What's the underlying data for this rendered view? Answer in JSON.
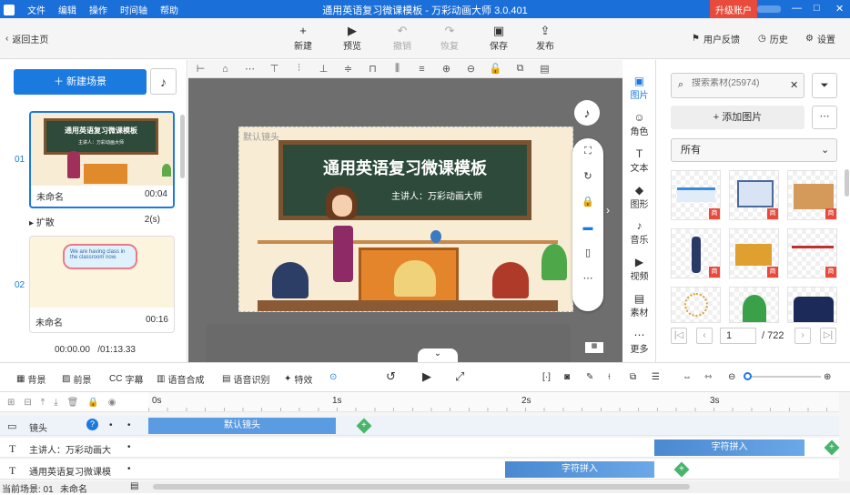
{
  "titlebar": {
    "menus": [
      "文件",
      "编辑",
      "操作",
      "时间轴",
      "帮助"
    ],
    "title": "通用英语复习微课模板 - 万彩动画大师 3.0.401",
    "upgrade": "升级账户",
    "min": "—",
    "max": "□",
    "close": "✕"
  },
  "toolbar": {
    "back": "返回主页",
    "buttons": [
      {
        "label": "新建",
        "icon": "+"
      },
      {
        "label": "预览",
        "icon": "▶"
      },
      {
        "label": "撤销",
        "icon": "↶"
      },
      {
        "label": "恢复",
        "icon": "↷"
      },
      {
        "label": "保存",
        "icon": "▣"
      },
      {
        "label": "发布",
        "icon": "⇪"
      }
    ],
    "feedback": "用户反馈",
    "history": "历史",
    "settings": "设置"
  },
  "left": {
    "new_scene": "新建场景",
    "scenes": [
      {
        "num": "01",
        "name": "未命名",
        "duration": "00:04",
        "board_title": "通用英语复习微课模板",
        "board_sub": "主讲人：万彩动画大师"
      },
      {
        "num": "02",
        "name": "未命名",
        "duration": "00:16",
        "bubble": "We are having class in the classroom now."
      }
    ],
    "transition": "扩散",
    "transition_time": "2(s)",
    "time_current": "00:00.00",
    "time_total": "/01:13.33"
  },
  "canvas": {
    "camera_label": "默认镜头",
    "board_title": "通用英语复习微课模板",
    "presenter": "主讲人：万彩动画大师"
  },
  "sidetabs": [
    {
      "label": "图片",
      "icon": "▣"
    },
    {
      "label": "角色",
      "icon": "☺"
    },
    {
      "label": "文本",
      "icon": "T"
    },
    {
      "label": "图形",
      "icon": "◆"
    },
    {
      "label": "音乐",
      "icon": "♪"
    },
    {
      "label": "视频",
      "icon": "▶"
    },
    {
      "label": "素材",
      "icon": "▤"
    },
    {
      "label": "更多",
      "icon": "⋯"
    }
  ],
  "rpanel": {
    "search_placeholder": "搜索素材(25974)",
    "add_image": "+ 添加图片",
    "category": "所有",
    "badge": "商",
    "page": "1",
    "total_pages": "/ 722"
  },
  "timeline": {
    "tools": [
      "背景",
      "前景",
      "字幕",
      "语音合成",
      "语音识别",
      "特效"
    ],
    "ticks": [
      "0s",
      "1s",
      "2s",
      "3s"
    ],
    "tracks": [
      {
        "name": "镜头",
        "clip": "默认镜头"
      },
      {
        "name": "主讲人：万彩动画大",
        "clip": "字符拼入"
      },
      {
        "name": "通用英语复习微课模",
        "clip": "字符拼入"
      }
    ],
    "status_scene": "当前场景: 01",
    "status_name": "未命名"
  }
}
